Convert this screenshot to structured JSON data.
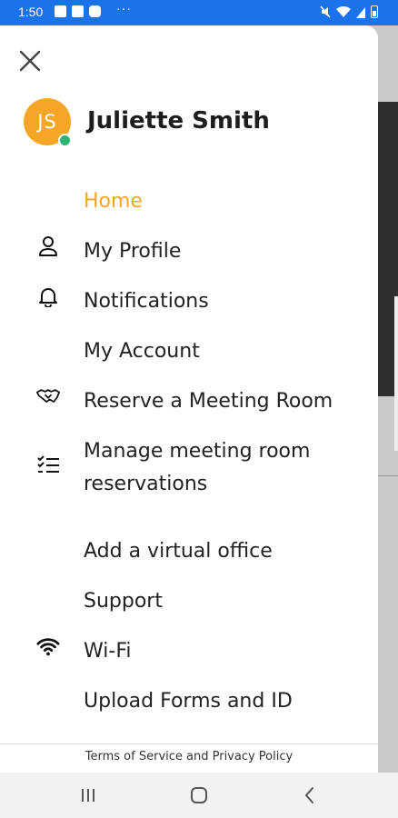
{
  "status_bar": {
    "time": "1:50",
    "dots": "···",
    "icons": [
      "image-icon",
      "gmail-icon",
      "youtube-icon",
      "mute-icon",
      "wifi-icon",
      "battery-icon"
    ]
  },
  "drawer": {
    "user": {
      "initials": "JS",
      "name": "Juliette Smith",
      "avatar_color": "#f4a624",
      "presence_color": "#2db673"
    },
    "items": [
      {
        "label": "Home",
        "icon": "",
        "active": true
      },
      {
        "label": "My Profile",
        "icon": "person-icon"
      },
      {
        "label": "Notifications",
        "icon": "bell-icon"
      },
      {
        "label": "My Account",
        "icon": ""
      },
      {
        "label": "Reserve a Meeting Room",
        "icon": "handshake-icon"
      },
      {
        "label": "Manage meeting room reservations",
        "icon": "checklist-icon"
      },
      {
        "label": "Add a virtual office",
        "icon": ""
      },
      {
        "label": "Support",
        "icon": ""
      },
      {
        "label": "Wi-Fi",
        "icon": "wifi-icon"
      },
      {
        "label": "Upload Forms and ID",
        "icon": ""
      }
    ],
    "footer": "Terms of Service and Privacy Policy",
    "accent_color": "#f4a624"
  },
  "nav_bar": {
    "buttons": [
      "recents-icon",
      "home-icon",
      "back-icon"
    ]
  }
}
